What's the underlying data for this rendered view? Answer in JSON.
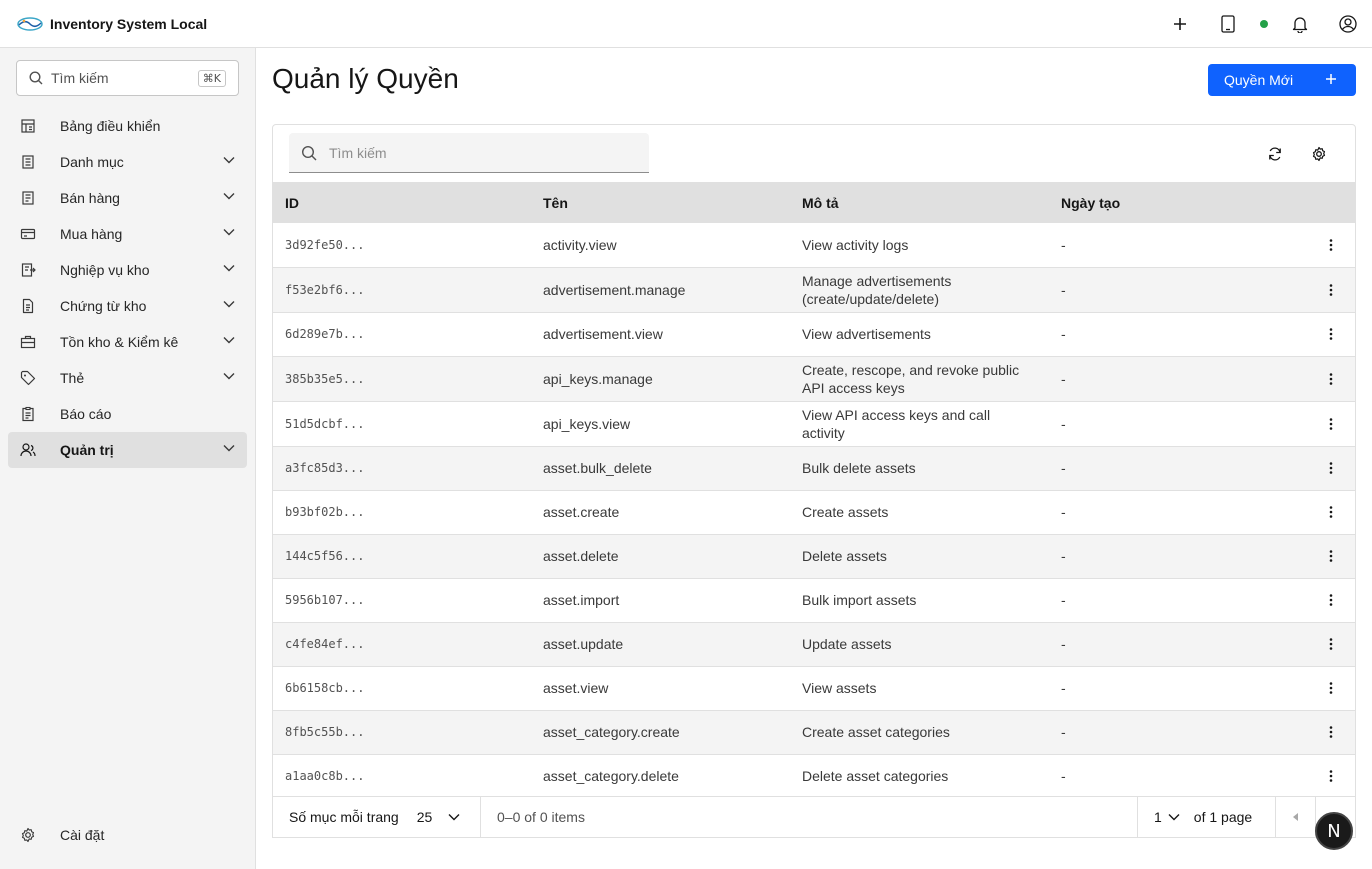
{
  "header": {
    "title": "Inventory System Local",
    "logo_icon": "brand-logo",
    "actions": [
      "add-icon",
      "tablet-icon",
      "status-dot",
      "notification-icon",
      "user-avatar-icon"
    ],
    "status_color": "#24a148"
  },
  "sidebar": {
    "search_placeholder": "Tìm kiếm",
    "search_shortcut": "⌘K",
    "items": [
      {
        "label": "Bảng điều khiển",
        "icon": "dashboard-icon",
        "expandable": false
      },
      {
        "label": "Danh mục",
        "icon": "catalog-icon",
        "expandable": true
      },
      {
        "label": "Bán hàng",
        "icon": "sales-icon",
        "expandable": true
      },
      {
        "label": "Mua hàng",
        "icon": "purchase-icon",
        "expandable": true
      },
      {
        "label": "Nghiệp vụ kho",
        "icon": "warehouse-ops-icon",
        "expandable": true
      },
      {
        "label": "Chứng từ kho",
        "icon": "document-icon",
        "expandable": true
      },
      {
        "label": "Tồn kho & Kiểm kê",
        "icon": "inventory-icon",
        "expandable": true
      },
      {
        "label": "Thẻ",
        "icon": "tag-icon",
        "expandable": true
      },
      {
        "label": "Báo cáo",
        "icon": "report-icon",
        "expandable": false
      },
      {
        "label": "Quản trị",
        "icon": "admin-icon",
        "expandable": true,
        "active": true
      }
    ],
    "footer_label": "Cài đặt"
  },
  "main": {
    "title": "Quản lý Quyền",
    "primary_button": "Quyền Mới",
    "accent": "#0f62fe",
    "table": {
      "search_placeholder": "Tìm kiếm",
      "columns": [
        "ID",
        "Tên",
        "Mô tả",
        "Ngày tạo"
      ],
      "rows": [
        {
          "id": "3d92fe50...",
          "name": "activity.view",
          "desc": "View activity logs",
          "created": "-"
        },
        {
          "id": "f53e2bf6...",
          "name": "advertisement.manage",
          "desc": "Manage advertisements (create/update/delete)",
          "created": "-"
        },
        {
          "id": "6d289e7b...",
          "name": "advertisement.view",
          "desc": "View advertisements",
          "created": "-"
        },
        {
          "id": "385b35e5...",
          "name": "api_keys.manage",
          "desc": "Create, rescope, and revoke public API access keys",
          "created": "-"
        },
        {
          "id": "51d5dcbf...",
          "name": "api_keys.view",
          "desc": "View API access keys and call activity",
          "created": "-"
        },
        {
          "id": "a3fc85d3...",
          "name": "asset.bulk_delete",
          "desc": "Bulk delete assets",
          "created": "-"
        },
        {
          "id": "b93bf02b...",
          "name": "asset.create",
          "desc": "Create assets",
          "created": "-"
        },
        {
          "id": "144c5f56...",
          "name": "asset.delete",
          "desc": "Delete assets",
          "created": "-"
        },
        {
          "id": "5956b107...",
          "name": "asset.import",
          "desc": "Bulk import assets",
          "created": "-"
        },
        {
          "id": "c4fe84ef...",
          "name": "asset.update",
          "desc": "Update assets",
          "created": "-"
        },
        {
          "id": "6b6158cb...",
          "name": "asset.view",
          "desc": "View assets",
          "created": "-"
        },
        {
          "id": "8fb5c55b...",
          "name": "asset_category.create",
          "desc": "Create asset categories",
          "created": "-"
        },
        {
          "id": "a1aa0c8b...",
          "name": "asset_category.delete",
          "desc": "Delete asset categories",
          "created": "-"
        }
      ]
    },
    "pagination": {
      "page_size_label": "Số mục mỗi trang",
      "page_size": "25",
      "range_text": "0–0 of 0 items",
      "current_page": "1",
      "total_pages_text": "of 1 page"
    }
  },
  "dev_badge": "N"
}
